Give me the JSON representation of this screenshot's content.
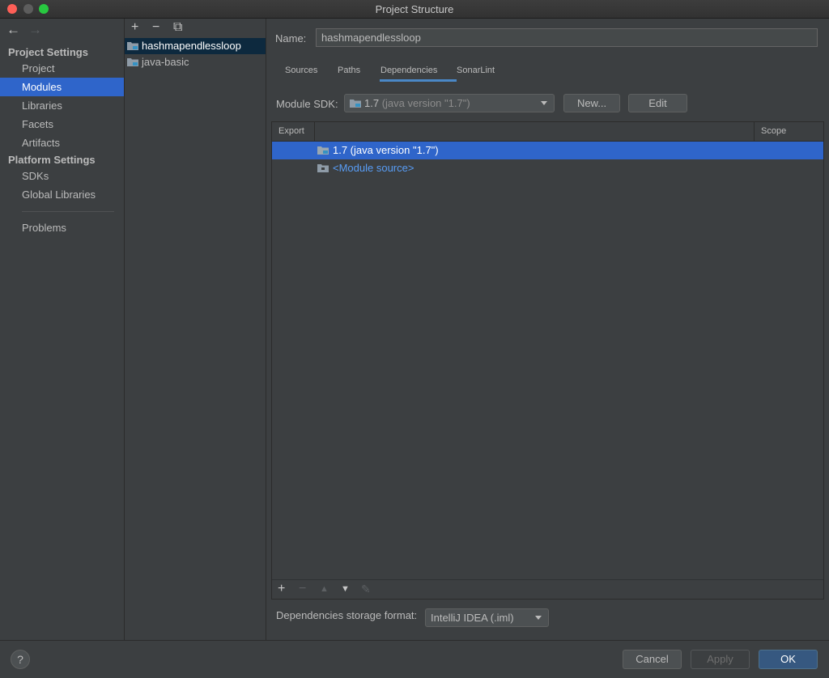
{
  "window": {
    "title": "Project Structure"
  },
  "nav": {
    "back_icon": "←",
    "forward_icon": "→"
  },
  "sidebar": {
    "project_settings_heading": "Project Settings",
    "project_items": [
      "Project",
      "Modules",
      "Libraries",
      "Facets",
      "Artifacts"
    ],
    "active_item": "Modules",
    "platform_settings_heading": "Platform Settings",
    "platform_items": [
      "SDKs",
      "Global Libraries"
    ],
    "problems": "Problems"
  },
  "modules": {
    "toolbar": {
      "add_icon": "+",
      "remove_icon": "−",
      "copy_icon": "⧉"
    },
    "items": [
      "hashmapendlessloop",
      "java-basic"
    ],
    "selected": "hashmapendlessloop"
  },
  "main": {
    "name_label": "Name:",
    "name_value": "hashmapendlessloop",
    "tabs": [
      "Sources",
      "Paths",
      "Dependencies",
      "SonarLint"
    ],
    "active_tab": "Dependencies",
    "sdk_label": "Module SDK:",
    "sdk_value": "1.7",
    "sdk_version": "(java version \"1.7\")",
    "new_button": "New...",
    "edit_button": "Edit",
    "table": {
      "col_export": "Export",
      "col_scope": "Scope",
      "rows": [
        {
          "label": "1.7 (java version \"1.7\")"
        },
        {
          "label": "<Module source>"
        }
      ]
    },
    "table_toolbar": {
      "add": "+",
      "remove": "−",
      "up": "▲",
      "down": "▼",
      "edit": "✎"
    },
    "storage_label": "Dependencies storage format:",
    "storage_value": "IntelliJ IDEA (.iml)"
  },
  "footer": {
    "help": "?",
    "cancel": "Cancel",
    "apply": "Apply",
    "ok": "OK"
  },
  "colors": {
    "selection": "#2f65ca",
    "link": "#589df6",
    "ok_button": "#365880"
  }
}
